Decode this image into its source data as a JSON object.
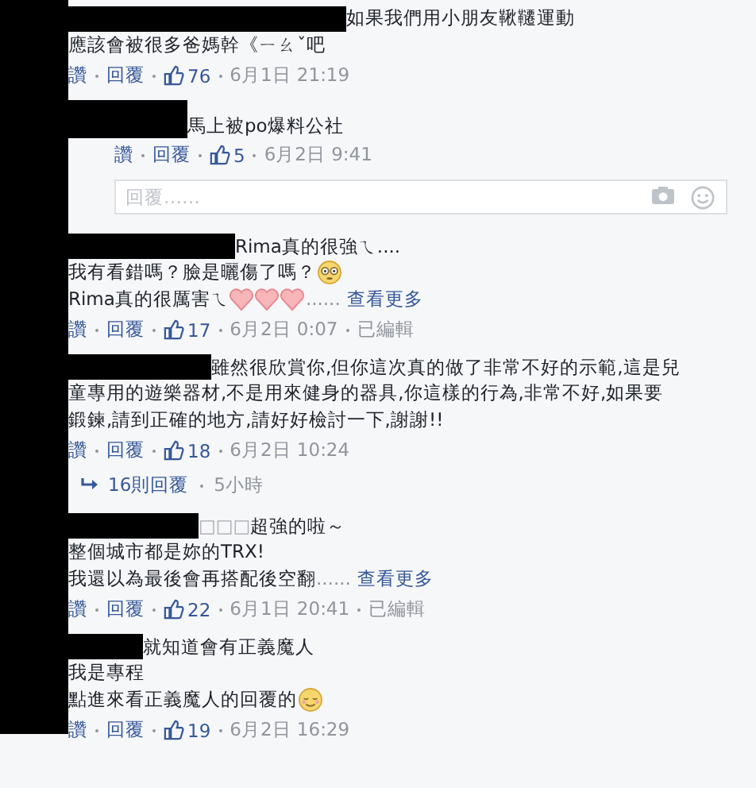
{
  "comments": [
    {
      "kind": "comment",
      "lines": [
        {
          "text": "如果我們用小朋友鞦韆運動"
        },
        {
          "text": "應該會被很多爸媽幹《ㄧㄠˇ吧"
        }
      ],
      "meta": {
        "like": "讚",
        "reply": "回覆",
        "likes": "76",
        "time": "6月1日 21:19"
      }
    },
    {
      "kind": "reply",
      "lines": [
        {
          "text": "馬上被po爆料公社"
        }
      ],
      "meta": {
        "like": "讚",
        "reply": "回覆",
        "likes": "5",
        "time": "6月2日 9:41"
      }
    },
    {
      "kind": "reply_box",
      "placeholder": "回覆……"
    },
    {
      "kind": "comment",
      "lines": [
        {
          "text": "Rima真的很強ㄟ...."
        },
        {
          "text": "我有看錯嗎？臉是曬傷了嗎？",
          "kind": "flushed"
        },
        {
          "text": "Rima真的很厲害ㄟ",
          "kind": "hearts",
          "after": "......",
          "more": "查看更多"
        }
      ],
      "meta": {
        "like": "讚",
        "reply": "回覆",
        "likes": "17",
        "time": "6月2日 0:07",
        "edited": "已編輯"
      }
    },
    {
      "kind": "comment",
      "lines": [
        {
          "text": "雖然很欣賞你,但你這次真的做了非常不好的示範,這是兒"
        },
        {
          "text": "童專用的遊樂器材,不是用來健身的器具,你這樣的行為,非常不好,如果要"
        },
        {
          "text": "鍛鍊,請到正確的地方,請好好檢討一下,謝謝!!"
        }
      ],
      "meta": {
        "like": "讚",
        "reply": "回覆",
        "likes": "18",
        "time": "6月2日 10:24"
      }
    },
    {
      "kind": "more_replies",
      "label": "16則回覆",
      "time": "5小時"
    },
    {
      "kind": "comment",
      "prefix": "□□□",
      "lines": [
        {
          "text": "超強的啦～"
        },
        {
          "text": "整個城市都是妳的TRX!"
        },
        {
          "text": "我還以為最後會再搭配後空翻",
          "after": "......",
          "more": "查看更多"
        }
      ],
      "meta": {
        "like": "讚",
        "reply": "回覆",
        "likes": "22",
        "time": "6月1日 20:41",
        "edited": "已編輯"
      }
    },
    {
      "kind": "comment",
      "lines": [
        {
          "text": "就知道會有正義魔人"
        },
        {
          "text": "我是專程"
        },
        {
          "text": "點進來看正義魔人的回覆的",
          "kind": "relieved"
        }
      ],
      "meta": {
        "like": "讚",
        "reply": "回覆",
        "likes": "19",
        "time": "6月2日 16:29"
      }
    }
  ]
}
